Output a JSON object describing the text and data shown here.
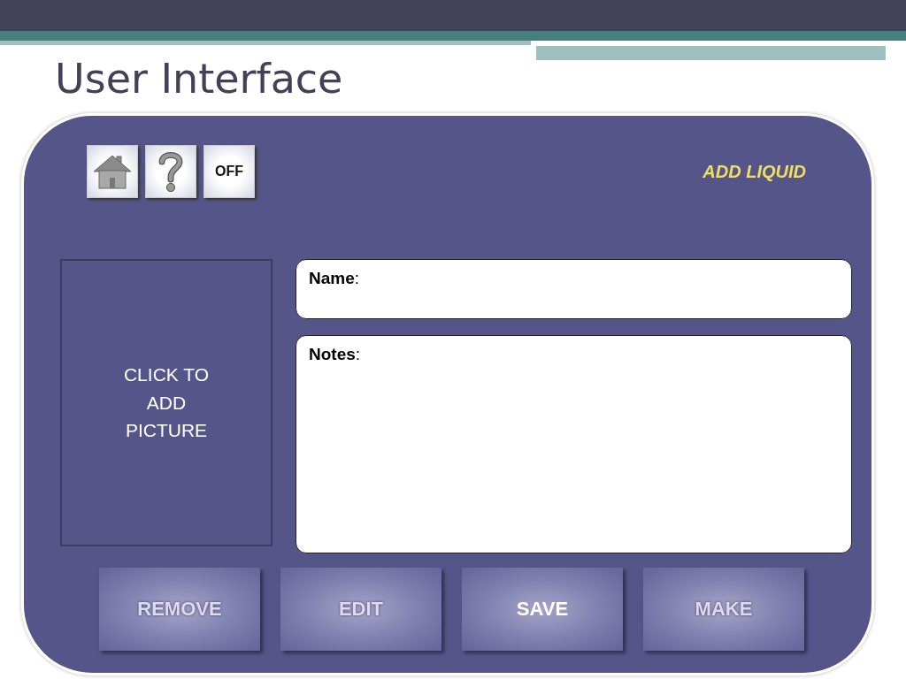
{
  "title": "User Interface",
  "toolbar": [
    {
      "kind": "home"
    },
    {
      "kind": "help"
    },
    {
      "kind": "text",
      "label": "OFF"
    }
  ],
  "mode_label": "ADD LIQUID",
  "picture_box": {
    "label": "CLICK TO\nADD\n PICTURE"
  },
  "fields": [
    {
      "kind": "line",
      "label": "**Name**:"
    },
    {
      "kind": "area",
      "label": "**Notes**:"
    }
  ],
  "buttons": [
    {
      "label": "REMOVE",
      "disabled": true
    },
    {
      "label": "EDIT",
      "disabled": true
    },
    {
      "label": "SAVE",
      "disabled": false
    },
    {
      "label": "MAKE",
      "disabled": true
    }
  ]
}
